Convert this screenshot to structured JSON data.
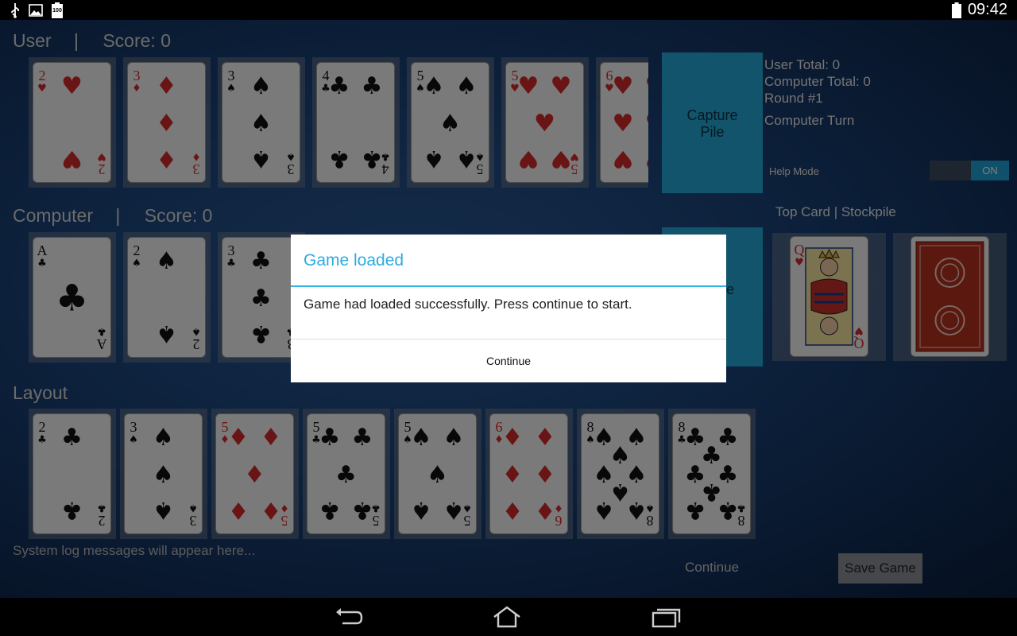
{
  "status_bar": {
    "time": "09:42",
    "battery_level": "100"
  },
  "user": {
    "name": "User",
    "separator": "|",
    "score": "Score: 0",
    "cards": [
      {
        "rank": "2",
        "suit": "hearts"
      },
      {
        "rank": "3",
        "suit": "diamonds"
      },
      {
        "rank": "3",
        "suit": "spades"
      },
      {
        "rank": "4",
        "suit": "clubs"
      },
      {
        "rank": "5",
        "suit": "spades"
      },
      {
        "rank": "5",
        "suit": "hearts"
      },
      {
        "rank": "6",
        "suit": "hearts"
      }
    ]
  },
  "computer": {
    "name": "Computer",
    "separator": "|",
    "score": "Score: 0",
    "cards": [
      {
        "rank": "A",
        "suit": "clubs"
      },
      {
        "rank": "2",
        "suit": "spades"
      },
      {
        "rank": "3",
        "suit": "clubs"
      }
    ]
  },
  "layout": {
    "title": "Layout",
    "cards": [
      {
        "rank": "2",
        "suit": "clubs"
      },
      {
        "rank": "3",
        "suit": "spades"
      },
      {
        "rank": "5",
        "suit": "diamonds"
      },
      {
        "rank": "5",
        "suit": "clubs"
      },
      {
        "rank": "5",
        "suit": "spades"
      },
      {
        "rank": "6",
        "suit": "diamonds"
      },
      {
        "rank": "8",
        "suit": "spades"
      },
      {
        "rank": "8",
        "suit": "clubs"
      }
    ]
  },
  "capture_pile": {
    "line1": "Capture",
    "line2": "Pile",
    "partial_label": "e"
  },
  "info": {
    "user_total": "User Total: 0",
    "computer_total": "Computer Total: 0",
    "round": "Round #1",
    "turn": "Computer Turn",
    "help_mode_label": "Help Mode",
    "help_mode_state": "ON"
  },
  "top_card": {
    "label": "Top Card | Stockpile",
    "card": {
      "rank": "Q",
      "suit": "hearts"
    }
  },
  "system_log": "System log messages will appear here...",
  "buttons": {
    "continue": "Continue",
    "save_game": "Save Game"
  },
  "dialog": {
    "title": "Game loaded",
    "message": "Game had loaded successfully. Press continue to start.",
    "button": "Continue"
  },
  "colors": {
    "red_suit": "#d42a2a",
    "black_suit": "#111111",
    "accent": "#33b5e5",
    "pile": "#24a9d6",
    "card_back": "#b4301e"
  }
}
